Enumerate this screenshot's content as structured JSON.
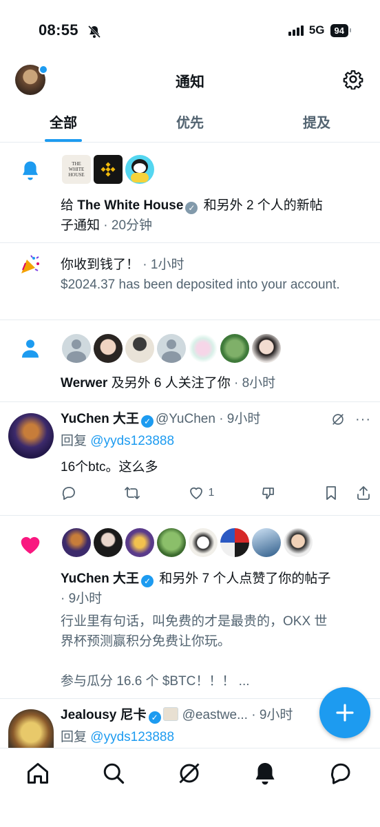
{
  "status_bar": {
    "time": "08:55",
    "network": "5G",
    "battery": "94"
  },
  "header": {
    "title": "通知"
  },
  "tabs": [
    {
      "label": "全部"
    },
    {
      "label": "优先"
    },
    {
      "label": "提及"
    }
  ],
  "notifications": {
    "new_posts": {
      "prefix": "给 ",
      "account": "The White House",
      "rest": " 和另外 2 个人的新帖",
      "line2": "子通知",
      "time": " · 20分钟",
      "avatar_labels": [
        "THE WHITE HOUSE"
      ]
    },
    "payment": {
      "title": "你收到钱了！",
      "time": " · 1小时",
      "body": "$2024.37 has been deposited into your account."
    },
    "follows": {
      "name": "Werwer",
      "rest": " 及另外 6 人关注了你",
      "time": " · 8小时"
    },
    "reply": {
      "name": "YuChen 大王",
      "handle": "@YuChen",
      "time": " · 9小时",
      "reply_prefix": "回复 ",
      "reply_to": "@yyds123888",
      "text": "16个btc。这么多",
      "like_count": "1"
    },
    "likes": {
      "name": "YuChen 大王",
      "rest": " 和另外 7 个人点赞了你的帖子",
      "time": "· 9小时",
      "text_line1": "行业里有句话，叫免费的才是最贵的，OKX 世",
      "text_line2": "界杯预测赢积分免费让你玩。",
      "text_line3": "参与瓜分 16.6 个 $BTC！！！ ..."
    },
    "reply2": {
      "name": "Jealousy 尼卡",
      "handle": "@eastwe...",
      "time": " · 9小时",
      "reply_prefix": "回复 ",
      "reply_to": "@yyds123888"
    }
  },
  "colors": {
    "accent": "#1d9bf0",
    "like": "#f91880",
    "text": "#0f1419",
    "muted": "#536471"
  }
}
